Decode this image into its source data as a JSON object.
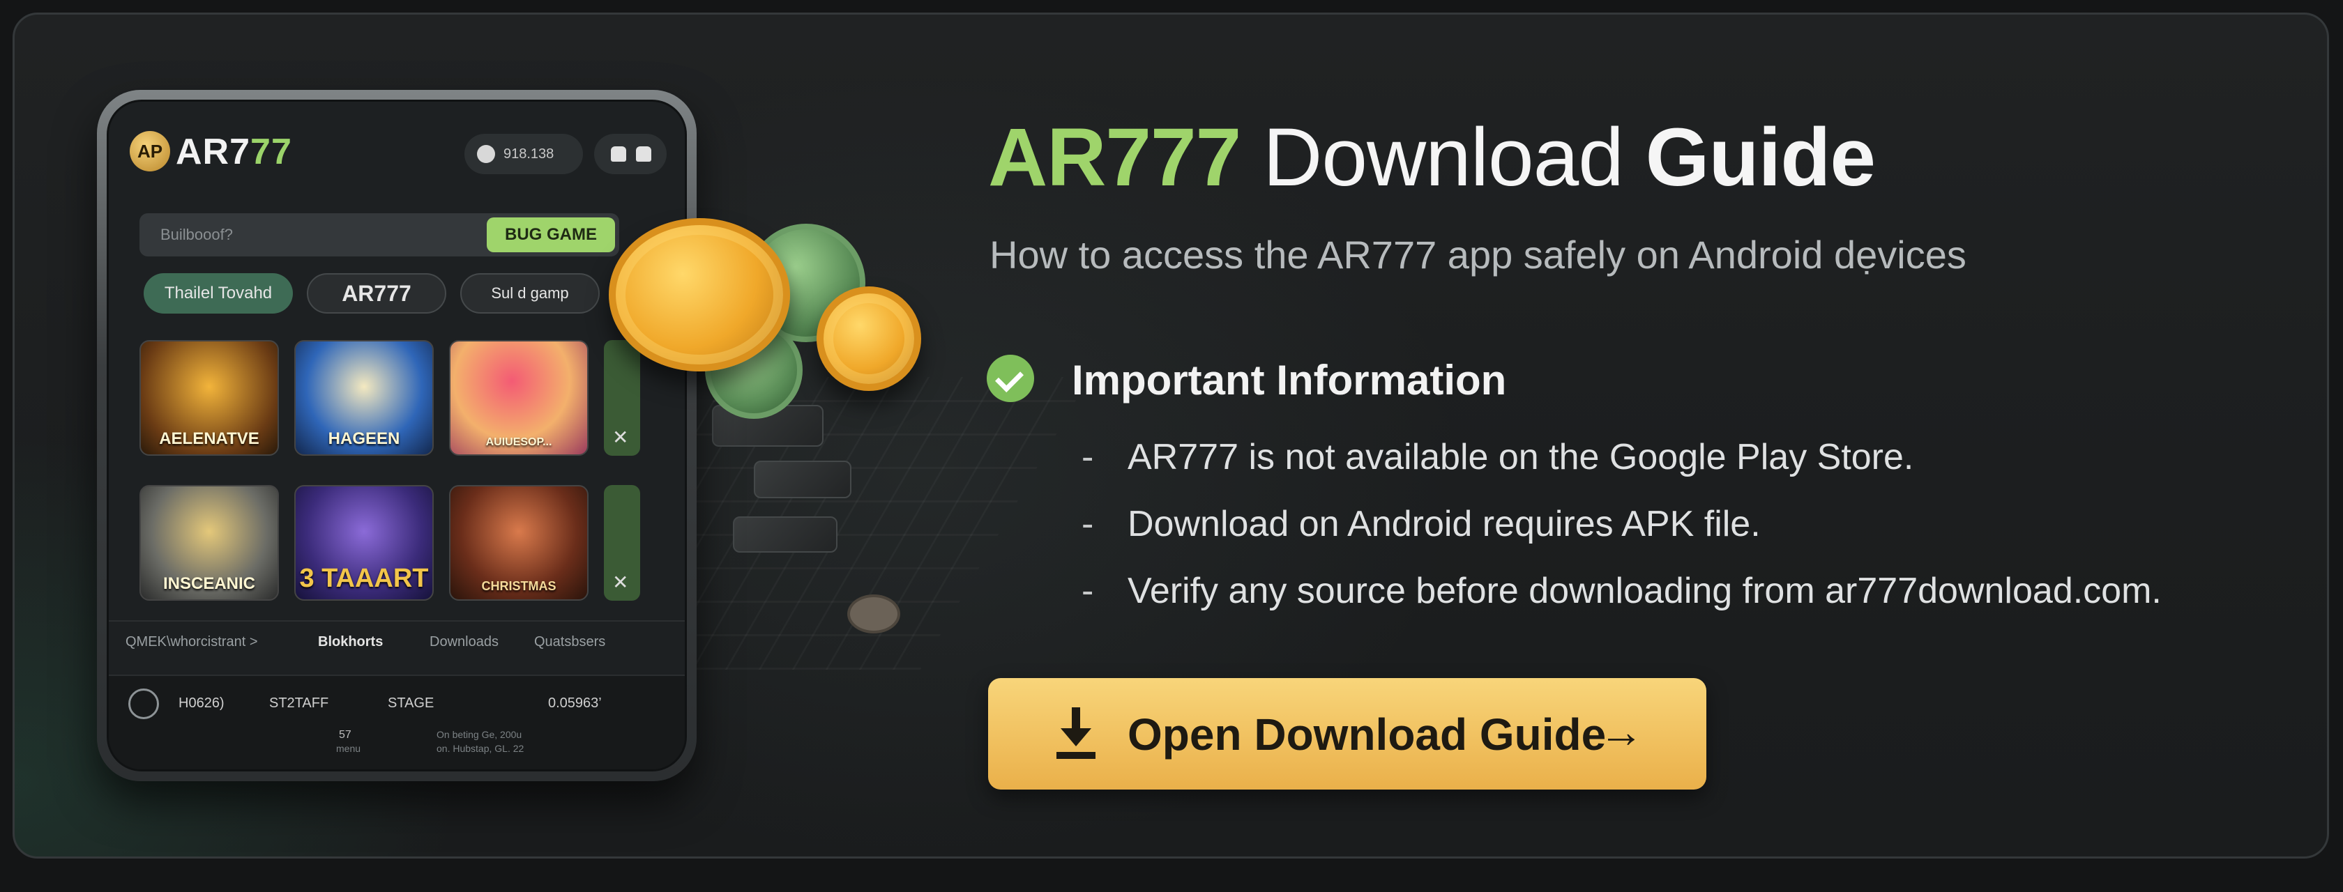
{
  "phone": {
    "logo_badge": "AP",
    "logo_prefix": "AR7",
    "logo_suffix": "77",
    "balance": "918.138",
    "search_placeholder": "Builbooof?",
    "search_button": "BUG GAME",
    "chips": [
      "Thailel Tovahd",
      "AR777",
      "Sul d gamp"
    ],
    "tiles": [
      "AELENATVE",
      "HAGEEN",
      "AUIUESOP...",
      "INSCEANIC",
      "3 TAAART",
      "CHRISTMAS"
    ],
    "nav": [
      "QMEK\\whorcistrant >",
      "Blokhorts",
      "Downloads",
      "Quatsbsers"
    ],
    "bottom": {
      "left": "H0626)",
      "status": "ST2TAFF",
      "stage": "STAGE",
      "value": "0.05963’",
      "count": "57",
      "count_label": "menu",
      "note1": "On beting Ge, 200u",
      "note2": "on. Hubstap, GL. 22"
    }
  },
  "title": {
    "brand": "AR777",
    "middle": " Download ",
    "end": "Guide"
  },
  "subtitle": "How to access the AR777 app safely on Android dẹvices",
  "info": {
    "heading": "Important Information",
    "bullets": [
      "AR777 is not available on the Google Play Store.",
      "Download on Android requires APK file.",
      "Verify any source before downloading from ar777download.com."
    ]
  },
  "cta": {
    "label": "Open Download Guide",
    "arrow": "→"
  },
  "colors": {
    "accent_green": "#9fd46b",
    "cta_gold": "#f3c55f"
  },
  "icons": [
    "check-circle-icon",
    "download-icon",
    "arrow-right-icon"
  ]
}
